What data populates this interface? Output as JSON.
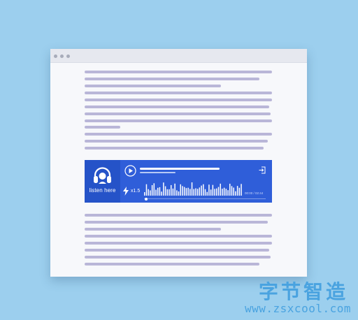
{
  "player": {
    "listen_label": "listen here",
    "speed_label": "x1.5",
    "time_label": "00:00 / 02:44",
    "progress": 0.02
  },
  "icons": {
    "headphone": "headphone-icon",
    "play": "play-icon",
    "speed": "lightning-bolt-icon",
    "share": "share-icon"
  },
  "colors": {
    "background": "#9ccfee",
    "player_accent": "#2f5ed9",
    "text_placeholder": "#b9b6d8",
    "watermark": "#4aa3e0"
  },
  "watermark": {
    "title": "字节智造",
    "url": "www.zsxcool.com"
  }
}
